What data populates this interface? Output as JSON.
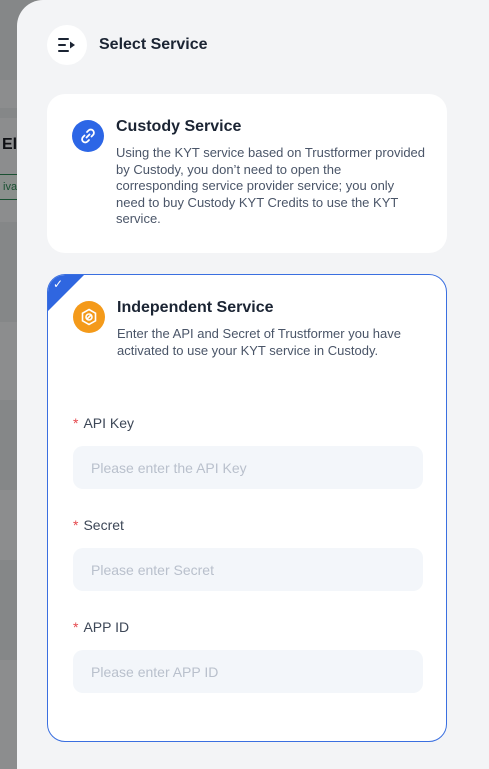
{
  "background": {
    "title_fragment": "El",
    "chip_fragment": "iva"
  },
  "drawer": {
    "title": "Select Service",
    "header_icon": "menu-collapse-icon"
  },
  "custody": {
    "title": "Custody Service",
    "description": "Using the KYT service based on Trustformer provided by Custody, you don’t need to open the corresponding service provider service; you only need to buy Custody KYT Credits to use the KYT service.",
    "icon": "link-icon",
    "accent": "#2c66e6"
  },
  "independent": {
    "title": "Independent Service",
    "description": "Enter the API and Secret of Trustformer you have activated to use your KYT service in Custody.",
    "icon": "hexagon-token-icon",
    "accent": "#f49a1a",
    "selected": true,
    "selected_accent": "#2f66e0",
    "fields": {
      "api_key": {
        "label": "API Key",
        "required_mark": "*",
        "value": "",
        "placeholder": "Please enter the API Key"
      },
      "secret": {
        "label": "Secret",
        "required_mark": "*",
        "value": "",
        "placeholder": "Please enter Secret"
      },
      "app_id": {
        "label": "APP ID",
        "required_mark": "*",
        "value": "",
        "placeholder": "Please enter APP ID"
      }
    }
  }
}
